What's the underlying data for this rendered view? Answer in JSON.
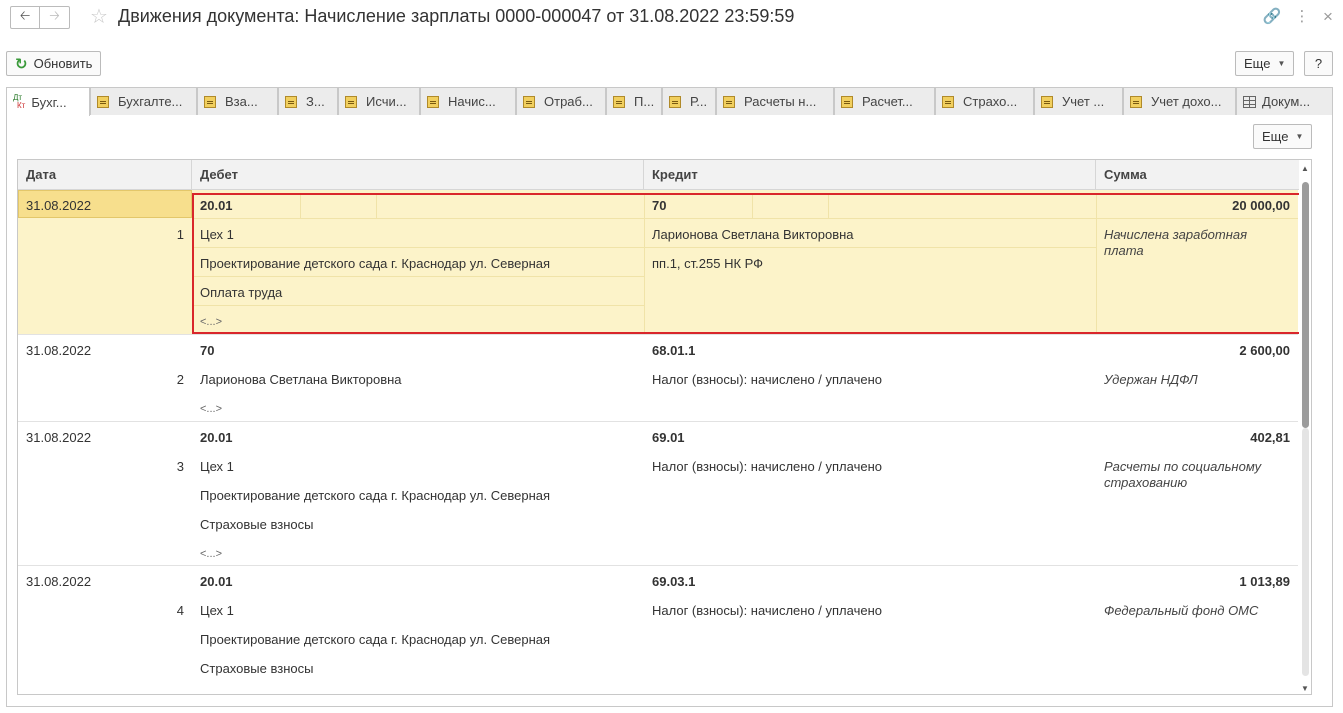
{
  "window": {
    "title": "Движения документа: Начисление зарплаты 0000-000047 от 31.08.2022 23:59:59"
  },
  "toolbar": {
    "refresh_label": "Обновить",
    "more_label": "Еще",
    "help_label": "?"
  },
  "tabs": [
    {
      "label": "Бухг...",
      "icon": "dt-kt-icon",
      "active": true
    },
    {
      "label": "Бухгалте...",
      "icon": "register-icon"
    },
    {
      "label": "Вза...",
      "icon": "register-icon"
    },
    {
      "label": "З...",
      "icon": "register-icon"
    },
    {
      "label": "Исчи...",
      "icon": "register-icon"
    },
    {
      "label": "Начис...",
      "icon": "register-icon"
    },
    {
      "label": "Отраб...",
      "icon": "register-icon"
    },
    {
      "label": "П...",
      "icon": "register-icon"
    },
    {
      "label": "Р...",
      "icon": "register-icon"
    },
    {
      "label": "Расчеты н...",
      "icon": "register-icon"
    },
    {
      "label": "Расчет...",
      "icon": "register-icon"
    },
    {
      "label": "Страхо...",
      "icon": "register-icon"
    },
    {
      "label": "Учет ...",
      "icon": "register-icon"
    },
    {
      "label": "Учет дохо...",
      "icon": "register-icon"
    },
    {
      "label": "Докум...",
      "icon": "table-icon"
    }
  ],
  "panel": {
    "more_label": "Еще"
  },
  "table": {
    "columns": [
      "Дата",
      "Дебет",
      "Кредит",
      "Сумма"
    ],
    "rows": [
      {
        "date": "31.08.2022",
        "num": "1",
        "selected": true,
        "debit": [
          "20.01",
          "Цех 1",
          "Проектирование детского сада г. Краснодар ул. Северная",
          "Оплата труда",
          "<...>"
        ],
        "credit": [
          "70",
          "Ларионова Светлана Викторовна",
          "пп.1, ст.255 НК РФ"
        ],
        "amount": "20 000,00",
        "content": "Начислена заработная плата"
      },
      {
        "date": "31.08.2022",
        "num": "2",
        "debit": [
          "70",
          "Ларионова Светлана Викторовна",
          "<...>"
        ],
        "credit": [
          "68.01.1",
          "Налог (взносы): начислено / уплачено"
        ],
        "amount": "2 600,00",
        "content": "Удержан НДФЛ"
      },
      {
        "date": "31.08.2022",
        "num": "3",
        "debit": [
          "20.01",
          "Цех 1",
          "Проектирование детского сада г. Краснодар ул. Северная",
          "Страховые взносы",
          "<...>"
        ],
        "credit": [
          "69.01",
          "Налог (взносы): начислено / уплачено"
        ],
        "amount": "402,81",
        "content": "Расчеты по социальному страхованию"
      },
      {
        "date": "31.08.2022",
        "num": "4",
        "debit": [
          "20.01",
          "Цех 1",
          "Проектирование детского сада г. Краснодар ул. Северная",
          "Страховые взносы",
          "<...>"
        ],
        "credit": [
          "69.03.1",
          "Налог (взносы): начислено / уплачено"
        ],
        "amount": "1 013,89",
        "content": "Федеральный фонд ОМС"
      }
    ]
  },
  "colors": {
    "selection_frame": "#d9262b",
    "selected_row": "#fcf3c9",
    "refresh_icon": "#3a9a3a"
  }
}
